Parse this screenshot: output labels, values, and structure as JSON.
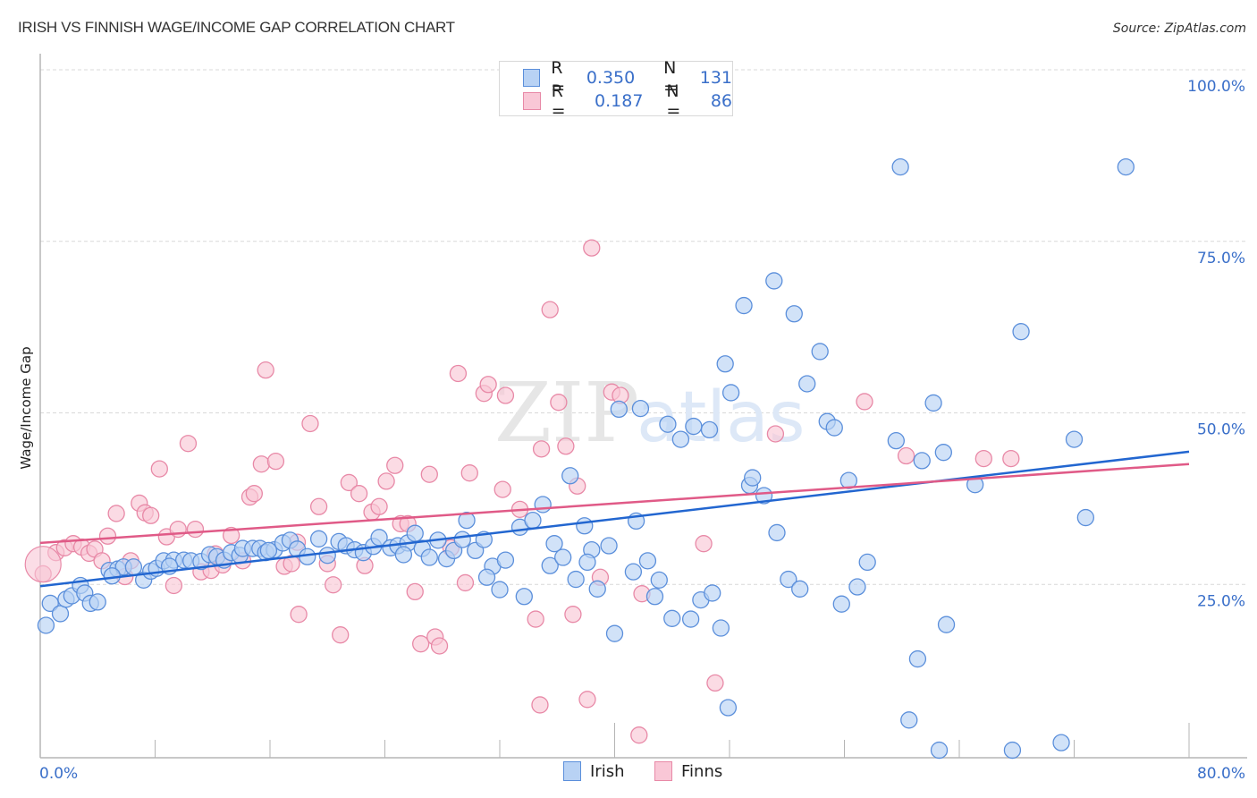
{
  "header": {
    "title": "IRISH VS FINNISH WAGE/INCOME GAP CORRELATION CHART",
    "source": "Source: ZipAtlas.com"
  },
  "legend": {
    "rows": [
      {
        "series": "Irish",
        "r_label": "R = ",
        "r_value": "0.350",
        "n_label": "N = ",
        "n_value": "131"
      },
      {
        "series": "Finns",
        "r_label": "R = ",
        "r_value": "0.187",
        "n_label": "N = ",
        "n_value": "86"
      }
    ]
  },
  "bottom_legend": [
    {
      "label": "Irish"
    },
    {
      "label": "Finns"
    }
  ],
  "colors": {
    "irish_fill": "#b8d2f4",
    "irish_stroke": "#5b8fdb",
    "irish_line": "#2266d0",
    "finns_fill": "#f9c7d6",
    "finns_stroke": "#e889a7",
    "finns_line": "#e05a87",
    "tick_label": "#3a6fc9",
    "grid": "#d9d9d9"
  },
  "chart_data": {
    "type": "scatter",
    "title": "IRISH VS FINNISH WAGE/INCOME GAP CORRELATION CHART",
    "xlabel": "",
    "ylabel": "Wage/Income Gap",
    "xlim": [
      0,
      80
    ],
    "ylim": [
      0,
      100
    ],
    "x_tick_labels": [
      "0.0%",
      "80.0%"
    ],
    "y_ticks": [
      25,
      50,
      75,
      100
    ],
    "y_tick_labels": [
      "25.0%",
      "50.0%",
      "75.0%",
      "100.0%"
    ],
    "grid": "horizontal dashed",
    "legend_placement": "top-center",
    "watermark": "ZIPatlas",
    "series": [
      {
        "name": "Irish",
        "r": 0.35,
        "n": 131,
        "trend": {
          "x": [
            0,
            80
          ],
          "y": [
            25.0,
            44.6
          ]
        },
        "points": [
          [
            0.4,
            19.3
          ],
          [
            0.7,
            22.5
          ],
          [
            1.4,
            21.0
          ],
          [
            1.8,
            23.1
          ],
          [
            2.2,
            23.6
          ],
          [
            2.8,
            25.1
          ],
          [
            3.1,
            24.0
          ],
          [
            3.5,
            22.5
          ],
          [
            4.0,
            22.7
          ],
          [
            4.8,
            27.3
          ],
          [
            5.4,
            27.5
          ],
          [
            5.8,
            27.8
          ],
          [
            6.5,
            27.8
          ],
          [
            7.2,
            25.9
          ],
          [
            7.7,
            27.2
          ],
          [
            8.1,
            27.6
          ],
          [
            8.6,
            28.7
          ],
          [
            9.3,
            28.8
          ],
          [
            10.0,
            28.8
          ],
          [
            10.5,
            28.7
          ],
          [
            11.2,
            28.6
          ],
          [
            11.8,
            29.6
          ],
          [
            12.3,
            29.3
          ],
          [
            12.8,
            28.8
          ],
          [
            13.3,
            29.9
          ],
          [
            13.9,
            29.5
          ],
          [
            14.1,
            30.5
          ],
          [
            14.8,
            30.5
          ],
          [
            15.3,
            30.5
          ],
          [
            15.7,
            29.9
          ],
          [
            16.3,
            30.3
          ],
          [
            16.9,
            31.3
          ],
          [
            17.4,
            31.7
          ],
          [
            17.9,
            30.4
          ],
          [
            18.6,
            29.3
          ],
          [
            19.4,
            31.9
          ],
          [
            20.0,
            29.5
          ],
          [
            20.8,
            31.5
          ],
          [
            21.3,
            30.9
          ],
          [
            21.9,
            30.3
          ],
          [
            22.5,
            29.9
          ],
          [
            23.2,
            30.8
          ],
          [
            23.6,
            32.1
          ],
          [
            24.4,
            30.6
          ],
          [
            24.9,
            30.9
          ],
          [
            25.6,
            31.3
          ],
          [
            26.1,
            32.7
          ],
          [
            26.6,
            30.5
          ],
          [
            27.1,
            29.2
          ],
          [
            27.7,
            31.7
          ],
          [
            28.3,
            29.0
          ],
          [
            28.8,
            30.2
          ],
          [
            29.4,
            31.8
          ],
          [
            29.7,
            34.6
          ],
          [
            30.3,
            30.2
          ],
          [
            30.9,
            31.8
          ],
          [
            31.5,
            27.9
          ],
          [
            32.0,
            24.5
          ],
          [
            32.4,
            28.8
          ],
          [
            33.4,
            33.6
          ],
          [
            33.7,
            23.5
          ],
          [
            34.3,
            34.6
          ],
          [
            35.0,
            36.9
          ],
          [
            35.5,
            28.0
          ],
          [
            35.8,
            31.2
          ],
          [
            36.4,
            29.2
          ],
          [
            36.9,
            41.1
          ],
          [
            37.3,
            26.0
          ],
          [
            37.9,
            33.8
          ],
          [
            38.4,
            30.3
          ],
          [
            38.8,
            24.6
          ],
          [
            39.6,
            30.9
          ],
          [
            40.0,
            18.1
          ],
          [
            40.3,
            50.8
          ],
          [
            41.3,
            27.1
          ],
          [
            41.5,
            34.5
          ],
          [
            41.8,
            50.9
          ],
          [
            42.3,
            28.7
          ],
          [
            42.8,
            23.5
          ],
          [
            43.1,
            25.9
          ],
          [
            43.7,
            48.6
          ],
          [
            44.0,
            20.3
          ],
          [
            44.6,
            46.4
          ],
          [
            45.3,
            20.2
          ],
          [
            45.5,
            48.3
          ],
          [
            46.0,
            23.0
          ],
          [
            46.6,
            47.8
          ],
          [
            47.4,
            18.9
          ],
          [
            47.7,
            57.4
          ],
          [
            47.9,
            7.3
          ],
          [
            48.1,
            53.2
          ],
          [
            49.0,
            65.9
          ],
          [
            49.4,
            39.7
          ],
          [
            49.6,
            40.8
          ],
          [
            50.4,
            38.2
          ],
          [
            51.1,
            69.5
          ],
          [
            51.3,
            32.8
          ],
          [
            52.1,
            26.0
          ],
          [
            52.5,
            64.7
          ],
          [
            52.9,
            24.6
          ],
          [
            53.4,
            54.5
          ],
          [
            54.3,
            59.2
          ],
          [
            54.8,
            49.0
          ],
          [
            55.3,
            48.1
          ],
          [
            55.8,
            22.4
          ],
          [
            56.3,
            40.4
          ],
          [
            56.9,
            24.9
          ],
          [
            59.6,
            46.2
          ],
          [
            59.9,
            86.1
          ],
          [
            60.5,
            5.5
          ],
          [
            61.1,
            14.4
          ],
          [
            61.4,
            43.3
          ],
          [
            62.2,
            51.7
          ],
          [
            62.6,
            1.1
          ],
          [
            62.9,
            44.5
          ],
          [
            63.1,
            19.4
          ],
          [
            65.1,
            39.8
          ],
          [
            67.7,
            1.1
          ],
          [
            68.3,
            62.1
          ],
          [
            71.1,
            2.2
          ],
          [
            72.0,
            46.4
          ],
          [
            72.8,
            35.0
          ],
          [
            75.6,
            86.1
          ],
          [
            5.0,
            26.5
          ],
          [
            9.0,
            27.9
          ],
          [
            15.9,
            30.2
          ],
          [
            25.3,
            29.6
          ],
          [
            31.1,
            26.3
          ],
          [
            38.1,
            28.5
          ],
          [
            46.8,
            24.0
          ],
          [
            57.6,
            28.5
          ]
        ]
      },
      {
        "name": "Finns",
        "r": 0.187,
        "n": 86,
        "trend": {
          "x": [
            0,
            80
          ],
          "y": [
            31.3,
            42.8
          ]
        },
        "points": [
          [
            0.2,
            26.8
          ],
          [
            1.1,
            29.9
          ],
          [
            1.7,
            30.6
          ],
          [
            2.3,
            31.2
          ],
          [
            2.9,
            30.7
          ],
          [
            3.4,
            29.8
          ],
          [
            3.8,
            30.4
          ],
          [
            4.3,
            28.7
          ],
          [
            4.7,
            32.3
          ],
          [
            5.3,
            35.6
          ],
          [
            5.9,
            26.4
          ],
          [
            6.3,
            28.7
          ],
          [
            6.9,
            37.1
          ],
          [
            7.3,
            35.7
          ],
          [
            7.7,
            35.3
          ],
          [
            8.3,
            42.1
          ],
          [
            8.8,
            32.2
          ],
          [
            9.3,
            25.1
          ],
          [
            9.6,
            33.3
          ],
          [
            10.3,
            45.8
          ],
          [
            10.8,
            33.3
          ],
          [
            11.2,
            27.1
          ],
          [
            11.9,
            27.3
          ],
          [
            12.2,
            29.7
          ],
          [
            12.7,
            28.1
          ],
          [
            13.3,
            32.4
          ],
          [
            14.1,
            28.7
          ],
          [
            14.6,
            38.0
          ],
          [
            14.9,
            38.5
          ],
          [
            15.4,
            42.8
          ],
          [
            15.7,
            56.5
          ],
          [
            16.4,
            43.2
          ],
          [
            17.0,
            27.9
          ],
          [
            17.5,
            28.3
          ],
          [
            17.9,
            31.4
          ],
          [
            18.0,
            20.9
          ],
          [
            18.8,
            48.7
          ],
          [
            19.4,
            36.6
          ],
          [
            20.0,
            28.3
          ],
          [
            20.4,
            25.2
          ],
          [
            20.9,
            17.9
          ],
          [
            21.5,
            40.1
          ],
          [
            22.2,
            38.5
          ],
          [
            22.6,
            28.0
          ],
          [
            23.1,
            35.8
          ],
          [
            23.6,
            36.6
          ],
          [
            24.1,
            40.3
          ],
          [
            24.7,
            42.6
          ],
          [
            25.1,
            34.1
          ],
          [
            25.6,
            34.1
          ],
          [
            26.1,
            24.2
          ],
          [
            26.5,
            16.6
          ],
          [
            27.1,
            41.3
          ],
          [
            27.5,
            17.6
          ],
          [
            27.8,
            16.3
          ],
          [
            28.6,
            30.6
          ],
          [
            29.1,
            56.0
          ],
          [
            29.6,
            25.5
          ],
          [
            29.9,
            41.5
          ],
          [
            30.9,
            53.1
          ],
          [
            31.2,
            54.4
          ],
          [
            32.2,
            39.1
          ],
          [
            32.4,
            52.8
          ],
          [
            33.4,
            36.2
          ],
          [
            34.5,
            20.2
          ],
          [
            34.8,
            7.7
          ],
          [
            34.9,
            45.0
          ],
          [
            35.5,
            65.3
          ],
          [
            36.1,
            51.8
          ],
          [
            36.6,
            45.4
          ],
          [
            37.1,
            20.9
          ],
          [
            37.4,
            39.6
          ],
          [
            38.1,
            8.5
          ],
          [
            38.4,
            74.3
          ],
          [
            39.0,
            26.3
          ],
          [
            39.8,
            53.3
          ],
          [
            40.4,
            52.8
          ],
          [
            41.7,
            3.3
          ],
          [
            41.9,
            23.9
          ],
          [
            46.2,
            31.2
          ],
          [
            47.0,
            10.9
          ],
          [
            51.2,
            47.2
          ],
          [
            57.4,
            51.9
          ],
          [
            60.3,
            44.0
          ],
          [
            65.7,
            43.6
          ],
          [
            67.6,
            43.6
          ]
        ]
      }
    ]
  }
}
